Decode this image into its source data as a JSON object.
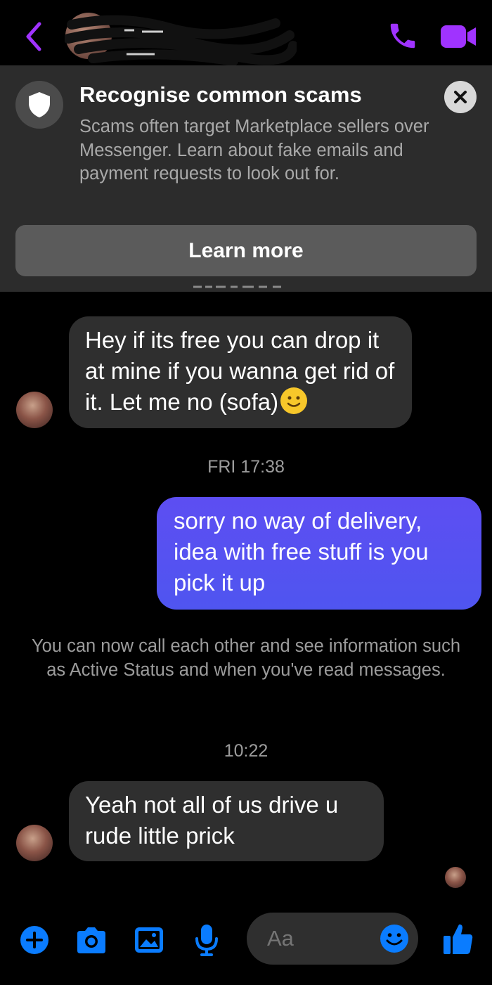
{
  "banner": {
    "title": "Recognise common scams",
    "body": "Scams often target Marketplace sellers over Messenger. Learn about fake emails and payment requests to look out for.",
    "button_label": "Learn more"
  },
  "messages": [
    {
      "from": "them",
      "text": "Hey if its free you can drop it at mine if you wanna get rid of it. Let me no (sofa)",
      "emoji": "slightly-smiling-face"
    },
    {
      "type": "timestamp",
      "text": "FRI 17:38"
    },
    {
      "from": "me",
      "text": "sorry no way of delivery, idea with free stuff is you pick it up"
    },
    {
      "type": "system",
      "text": "You can now call each other and see information such as Active Status and when you've read messages."
    },
    {
      "type": "timestamp",
      "text": "10:22"
    },
    {
      "from": "them",
      "text": "Yeah not all of us drive u rude little prick"
    }
  ],
  "composer": {
    "placeholder": "Aa"
  },
  "colors": {
    "accent": "#a033ff",
    "toolbar_blue": "#0a7cff",
    "outgoing_bubble": "#5b4df0",
    "incoming_bubble": "#2f2f2f",
    "banner_bg": "#2c2c2c"
  },
  "icons": {
    "header": [
      "back-chevron-icon",
      "phone-icon",
      "video-camera-icon"
    ],
    "toolbar": [
      "plus-icon",
      "camera-icon",
      "image-icon",
      "microphone-icon",
      "emoji-icon",
      "thumbs-up-icon"
    ]
  }
}
